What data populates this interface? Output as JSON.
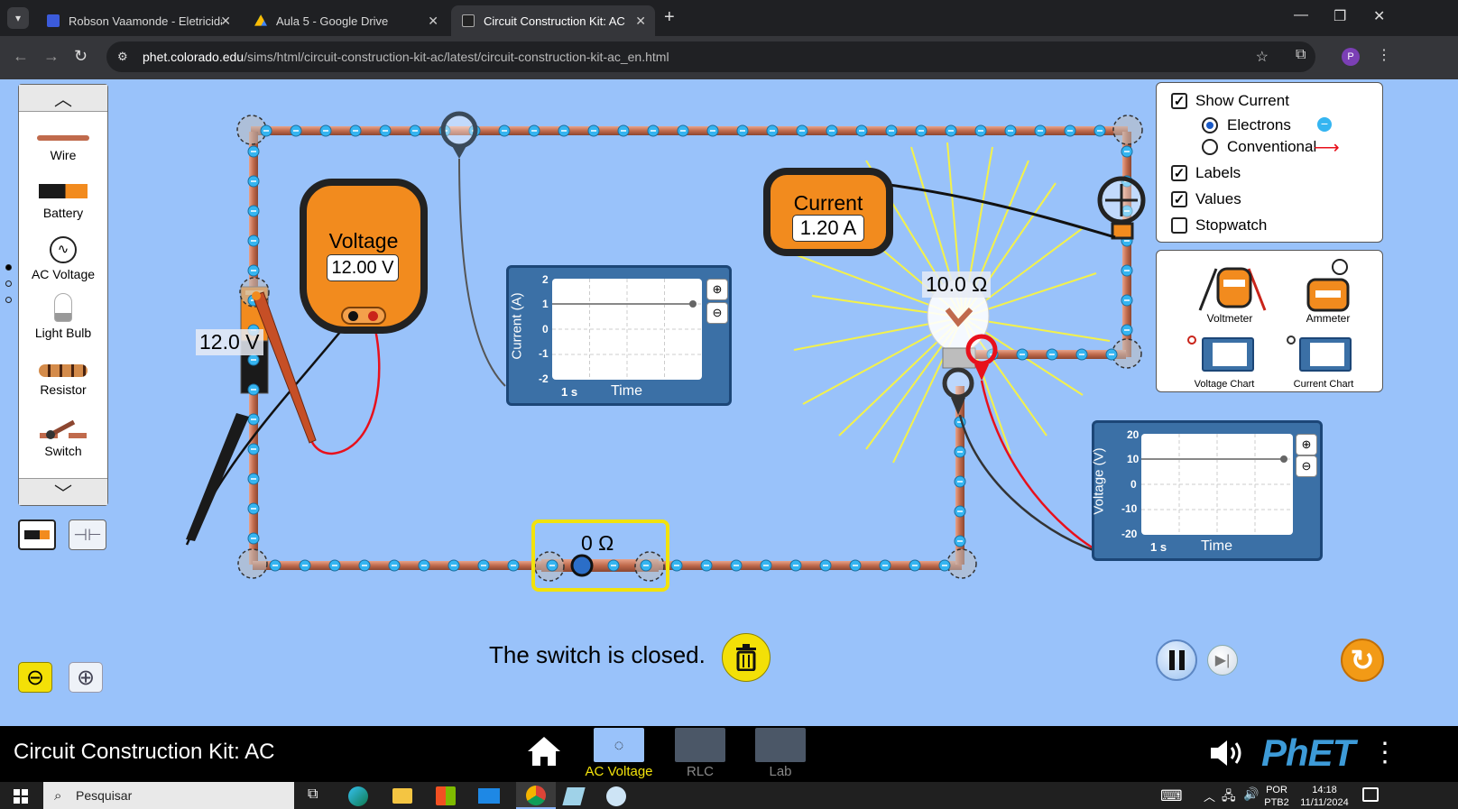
{
  "browser": {
    "tabs": [
      {
        "title": "Robson Vaamonde - Eletricidad",
        "icon_color": "#3b5bdb"
      },
      {
        "title": "Aula 5 - Google Drive",
        "icon_color": "#fbbc05"
      },
      {
        "title": "Circuit Construction Kit: AC",
        "icon_color": "#222222"
      }
    ],
    "url_host": "phet.colorado.edu",
    "url_path": "/sims/html/circuit-construction-kit-ac/latest/circuit-construction-kit-ac_en.html",
    "profile_initial": "P"
  },
  "toolbox": {
    "items": [
      {
        "label": "Wire",
        "icon": "wire-icon"
      },
      {
        "label": "Battery",
        "icon": "battery-icon"
      },
      {
        "label": "AC Voltage",
        "icon": "ac-source-icon"
      },
      {
        "label": "Light Bulb",
        "icon": "light-bulb-icon"
      },
      {
        "label": "Resistor",
        "icon": "resistor-icon"
      },
      {
        "label": "Switch",
        "icon": "switch-icon"
      }
    ]
  },
  "options": {
    "show_current": {
      "label": "Show Current",
      "checked": true
    },
    "electrons": {
      "label": "Electrons",
      "selected": true
    },
    "conventional": {
      "label": "Conventional",
      "selected": false
    },
    "labels": {
      "label": "Labels",
      "checked": true
    },
    "values": {
      "label": "Values",
      "checked": true
    },
    "stopwatch": {
      "label": "Stopwatch",
      "checked": false
    }
  },
  "sensors": {
    "voltmeter": "Voltmeter",
    "ammeter": "Ammeter",
    "voltage_chart": "Voltage Chart",
    "current_chart": "Current Chart",
    "mini_voltage": "Voltage",
    "mini_current": "Current"
  },
  "voltmeter": {
    "title": "Voltage",
    "value": "12.00 V"
  },
  "ammeter": {
    "title": "Current",
    "value": "1.20 A"
  },
  "current_chart": {
    "ylabel": "Current (A)",
    "xlabel": "Time",
    "scale": "1 s",
    "ticks": [
      "2",
      "1",
      "0",
      "-1",
      "-2"
    ],
    "level": 1.0
  },
  "voltage_chart": {
    "ylabel": "Voltage (V)",
    "xlabel": "Time",
    "scale": "1 s",
    "ticks": [
      "20",
      "10",
      "0",
      "-10",
      "-20"
    ],
    "level": 10.0
  },
  "circuit": {
    "battery_label": "12.0 V",
    "bulb_label": "10.0 Ω",
    "switch_label": "0 Ω"
  },
  "status_text": "The switch is closed.",
  "phet_bar": {
    "title": "Circuit Construction Kit: AC",
    "screens": [
      "AC Voltage",
      "RLC",
      "Lab"
    ],
    "active_screen": "AC Voltage",
    "logo": "PhET"
  },
  "taskbar": {
    "search_placeholder": "Pesquisar",
    "lang": "POR",
    "layout": "PTB2",
    "time": "14:18",
    "date": "11/11/2024"
  }
}
